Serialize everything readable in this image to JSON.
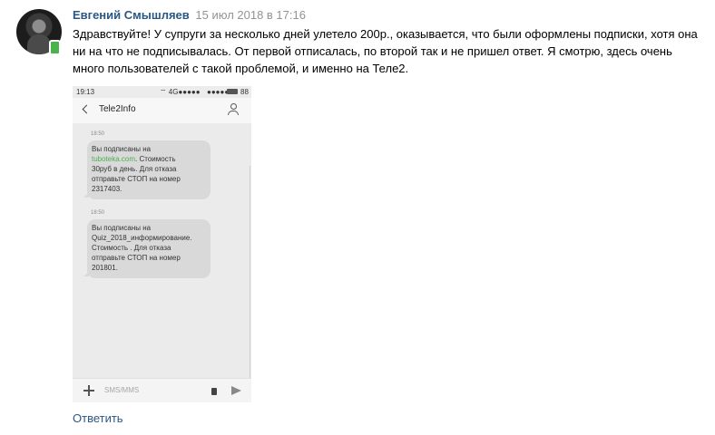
{
  "comment": {
    "author": "Евгений Смышляев",
    "date": "15 июл 2018 в 17:16",
    "text": "Здравствуйте! У супруги за несколько дней улетело 200р., оказывается, что были оформлены подписки, хотя она ни на что не подписывалась. От первой отписалась, по второй так и не пришел ответ. Я смотрю, здесь очень много пользователей с такой проблемой, и именно на Теле2.",
    "reply_label": "Ответить"
  },
  "phone": {
    "status_time": "19:13",
    "status_signal": "4G",
    "battery": "88",
    "contact_name": "Tele2Info",
    "messages": [
      {
        "time": "18:50",
        "before_link": "Вы  подписаны на",
        "link": "tuboteka.com",
        "after_link": ". Стоимость\n30руб в день. Для отказа\nотправьте СТОП  на номер\n2317403."
      },
      {
        "time": "18:50",
        "text": "Вы  подписаны на\nQuiz_2018_информирование.\nСтоимость . Для отказа\nотправьте СТОП  на номер\n201801."
      }
    ],
    "input_placeholder": "SMS/MMS"
  },
  "colors": {
    "author_link": "#2a5885",
    "date_gray": "#939393",
    "online_mobile": "#4bb34b",
    "sms_link": "#4caf50"
  },
  "icons": [
    "mobile-online-icon",
    "back-arrow-icon",
    "contact-icon",
    "plus-icon",
    "sim-card-icon",
    "send-icon"
  ]
}
